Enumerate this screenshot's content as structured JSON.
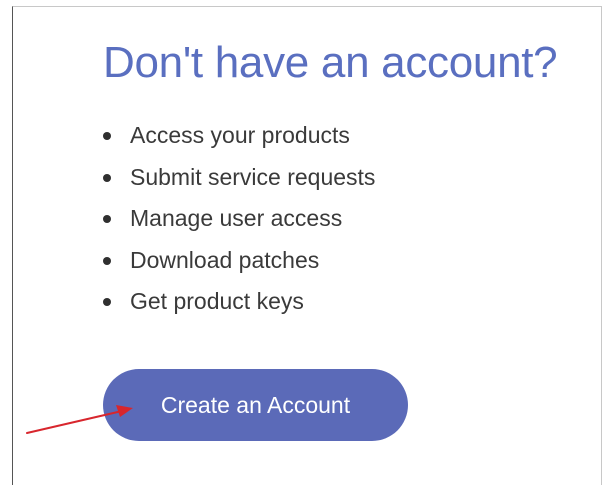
{
  "signup": {
    "heading": "Don't have an account?",
    "benefits": [
      "Access your products",
      "Submit service requests",
      "Manage user access",
      "Download patches",
      "Get product keys"
    ],
    "create_account_label": "Create an Account"
  },
  "colors": {
    "heading": "#5a6fc0",
    "button": "#5b6ab8",
    "annotation_arrow": "#d8262d"
  },
  "annotation": {
    "icon": "red-arrow-icon"
  }
}
